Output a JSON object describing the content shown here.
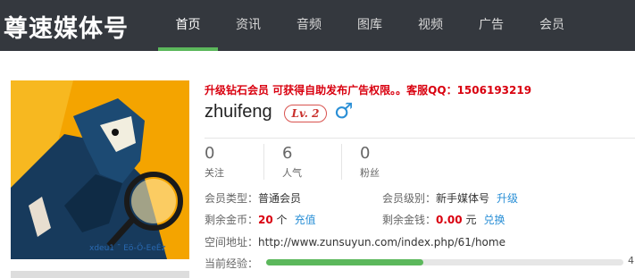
{
  "brand": {
    "logo_text": "尊速媒体号"
  },
  "nav": {
    "items": [
      "首页",
      "资讯",
      "音频",
      "图库",
      "视频",
      "广告",
      "会员"
    ],
    "active_index": 0
  },
  "colors": {
    "topbar": "#34383e",
    "accent_green": "#5cb85c",
    "notice_red": "#d9000f",
    "link_blue": "#2a8fd6"
  },
  "notice": {
    "text": "升级钻石会员 可获得自助发布广告权限。。客服QQ：1506193219"
  },
  "avatar": {
    "caption": "xdeu1 ¯ Eö-Ö-EeÉz"
  },
  "profile": {
    "username": "zhuifeng",
    "level_label": "Lv. 2",
    "gender_icon": "male-icon",
    "gender_symbol": "♂"
  },
  "stats": [
    {
      "value": "0",
      "label": "关注"
    },
    {
      "value": "6",
      "label": "人气"
    },
    {
      "value": "0",
      "label": "粉丝"
    }
  ],
  "details": {
    "member_type_label": "会员类型：",
    "member_type_value": "普通会员",
    "member_level_label": "会员级别：",
    "member_level_value": "新手媒体号",
    "upgrade_link": "升级",
    "gold_label": "剩余金币：",
    "gold_value": "20",
    "gold_unit": "个",
    "recharge_link": "充值",
    "money_label": "剩余金钱：",
    "money_value": "0.00",
    "money_unit": "元",
    "exchange_link": "兑换",
    "space_label": "空间地址：",
    "space_url": "http://www.zunsuyun.com/index.php/61/home",
    "exp_label": "当前经验：",
    "exp_value": "4",
    "exp_fraction": 0.44
  }
}
